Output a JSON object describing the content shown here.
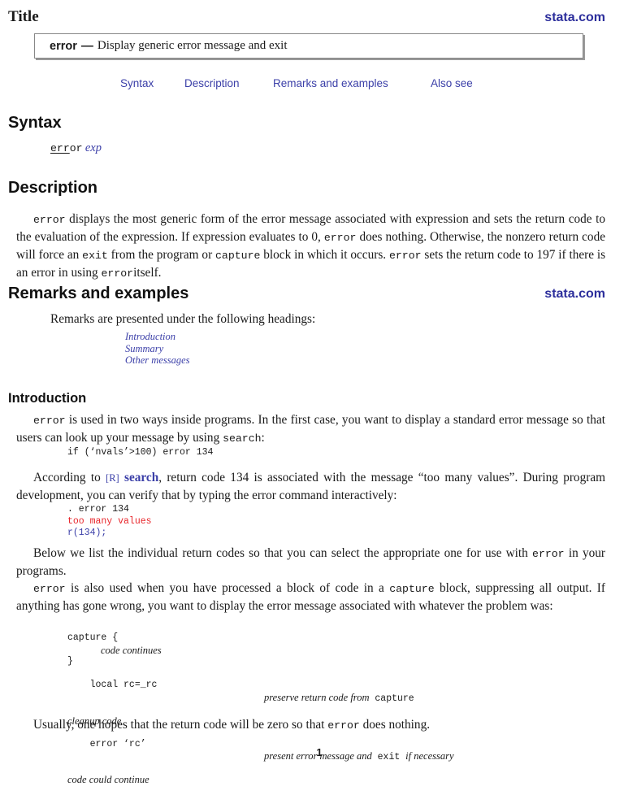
{
  "header": {
    "section_label": "Title",
    "site_link": "stata.com",
    "command": "error",
    "dash": "—",
    "description": "Display generic error message and exit"
  },
  "nav": {
    "items": [
      {
        "label": "Syntax"
      },
      {
        "label": "Description"
      },
      {
        "label": "Remarks and examples"
      },
      {
        "label": "Also see"
      }
    ]
  },
  "syntax": {
    "heading": "Syntax",
    "cmd_underlined": "err",
    "cmd_rest": "or",
    "arg": "exp"
  },
  "description": {
    "heading": "Description",
    "p1": "displays the most generic form of the error message associated with expression and sets the return code to the evaluation of the expression. If expression evaluates to 0,",
    "p2": "does nothing. Otherwise, the nonzero return code will force an",
    "p3": "from the program or",
    "p4": "block in which it occurs.",
    "p5": "sets the return code to 197 if there is an error in using",
    "p6": "itself.",
    "code_error": "error",
    "code_exit": "exit",
    "code_capture": "capture"
  },
  "remarks": {
    "heading": "Remarks and examples",
    "site_link": "stata.com",
    "intro_text": "Remarks are presented under the following headings:",
    "headings_links": [
      "Introduction",
      "Summary",
      "Other messages"
    ]
  },
  "introduction": {
    "heading": "Introduction",
    "p1_a": "is used in two ways inside programs. In the first case, you want to display a standard error message so that users can look up your message by using",
    "p1_code": "search",
    "p1_end": ":",
    "example1": "if (‘nvals’>100) error 134",
    "p2_a": "According to",
    "p2_ref": "[R]",
    "p2_ref_cmd": "search",
    "p2_b": ", return code 134 is associated with the message “too many values”. During program development, you can verify that by typing the error command interactively:",
    "example2": {
      "cmd": ". error 134",
      "msg": "too many values",
      "rc": "r(134);"
    },
    "p3_a": "Below we list the individual return codes so that you can select the appropriate one for use with",
    "p3_b": "in your programs.",
    "p4_a": "is also used when you have processed a block of code in a",
    "p4_b": "block, suppressing all output. If anything has gone wrong, you want to display the error message associated with whatever the problem was:",
    "example3": {
      "line1": "capture {",
      "line2": "code continues",
      "line3": "}",
      "line4": "local rc=_rc",
      "line4_comment_a": "preserve return code from",
      "line4_comment_code": "capture",
      "line5": "cleanup code",
      "line6": "error ‘rc’",
      "line6_comment_a": "present error message and",
      "line6_comment_code": "exit",
      "line6_comment_b": "if necessary",
      "line7": "code could continue"
    },
    "p5_a": "Usually, one hopes that the return code will be zero so that",
    "p5_b": "does nothing."
  },
  "footer": {
    "page_number": "1"
  },
  "colors": {
    "link": "#3b3fa8",
    "site_link": "#2d2f9c",
    "error_text": "#e8262b"
  }
}
